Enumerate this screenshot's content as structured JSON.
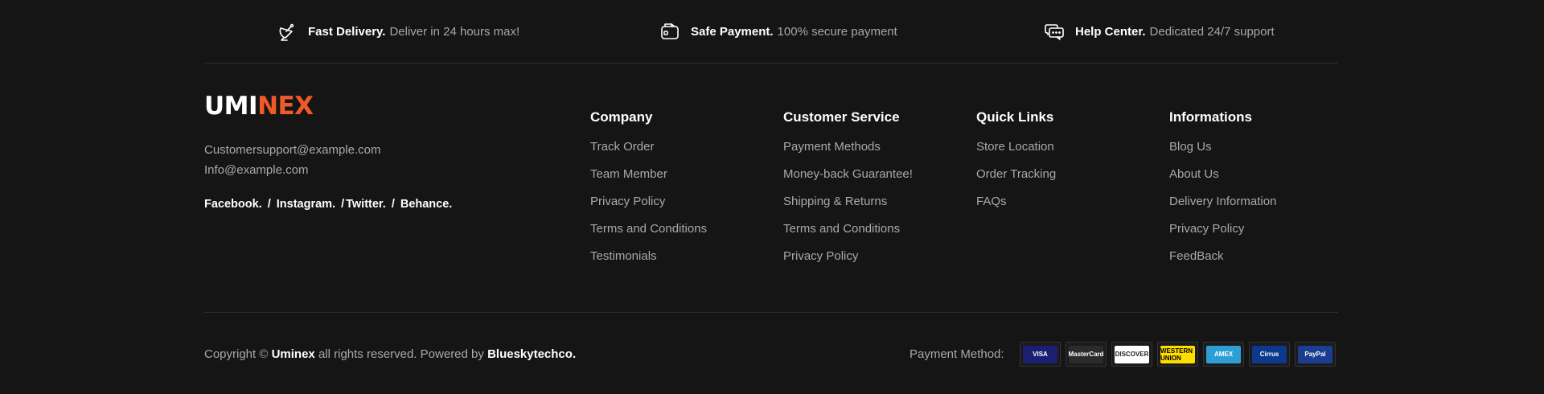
{
  "features": [
    {
      "icon": "satellite-dish-icon",
      "title": "Fast Delivery.",
      "text": "Deliver in 24 hours max!"
    },
    {
      "icon": "wallet-icon",
      "title": "Safe Payment.",
      "text": "100% secure payment"
    },
    {
      "icon": "chat-bubbles-icon",
      "title": "Help Center.",
      "text": "Dedicated 24/7 support"
    }
  ],
  "brand": {
    "logo_a": "UMI",
    "logo_b": "NEX",
    "emails": [
      "Customersupport@example.com",
      "Info@example.com"
    ],
    "socials": [
      "Facebook.",
      "Instagram.",
      "Twitter.",
      "Behance."
    ],
    "social_separator": "/"
  },
  "columns": [
    {
      "title": "Company",
      "links": [
        "Track Order",
        "Team Member",
        "Privacy Policy",
        "Terms and Conditions",
        "Testimonials"
      ]
    },
    {
      "title": "Customer Service",
      "links": [
        "Payment Methods",
        "Money-back Guarantee!",
        "Shipping & Returns",
        "Terms and Conditions",
        "Privacy Policy"
      ]
    },
    {
      "title": "Quick Links",
      "links": [
        "Store Location",
        "Order Tracking",
        "FAQs"
      ]
    },
    {
      "title": "Informations",
      "links": [
        "Blog Us",
        "About Us",
        "Delivery Information",
        "Privacy Policy",
        "FeedBack"
      ]
    }
  ],
  "bottom": {
    "copy_prefix": "Copyright ©",
    "brand": "Uminex",
    "copy_middle": "all rights reserved. Powered by",
    "powered_by": "Blueskytechco.",
    "payment_label": "Payment Method:",
    "cards": [
      {
        "name": "visa",
        "label": "VISA",
        "bg": "#1a1f71",
        "fg": "#ffffff"
      },
      {
        "name": "mastercard",
        "label": "MasterCard",
        "bg": "#2b2b2b",
        "fg": "#ffffff"
      },
      {
        "name": "discover",
        "label": "DISCOVER",
        "bg": "#ffffff",
        "fg": "#222222"
      },
      {
        "name": "western-union",
        "label": "WESTERN UNION",
        "bg": "#ffdd00",
        "fg": "#000000"
      },
      {
        "name": "amex",
        "label": "AMEX",
        "bg": "#2e9fd6",
        "fg": "#ffffff"
      },
      {
        "name": "cirrus",
        "label": "Cirrus",
        "bg": "#0b3a8c",
        "fg": "#ffffff"
      },
      {
        "name": "paypal",
        "label": "PayPal",
        "bg": "#1a3d8f",
        "fg": "#ffffff"
      }
    ]
  },
  "colors": {
    "accent": "#f05a28",
    "background": "#151515"
  }
}
